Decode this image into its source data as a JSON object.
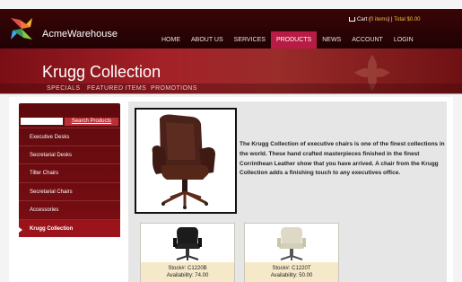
{
  "site": {
    "brand": "AcmeWarehouse",
    "cart": {
      "prefix": "Cart (",
      "items": "0 items",
      "separator": ") |",
      "total": "Total $0.00"
    },
    "nav": [
      "HOME",
      "ABOUT US",
      "SERVICES",
      "PRODUCTS",
      "NEWS",
      "ACCOUNT",
      "LOGIN"
    ],
    "active_nav": "PRODUCTS"
  },
  "banner": {
    "title": "Krugg Collection",
    "subnav": [
      "SPECIALS",
      "FEATURED ITEMS",
      "PROMOTIONS"
    ]
  },
  "sidebar": {
    "search": {
      "button": "Search Products",
      "value": ""
    },
    "items": [
      {
        "label": "Executive Desks"
      },
      {
        "label": "Secretarial Desks"
      },
      {
        "label": "Tilter Chairs"
      },
      {
        "label": "Secretarial Chairs"
      },
      {
        "label": "Accessories"
      },
      {
        "label": "Krugg Collection"
      }
    ]
  },
  "product": {
    "description": "The Krugg Collection of executive chairs is one of the finest collections in the world. These hand crafted masterpieces finished in the finest Corrinthean Leather show that you have arrived. A chair from the Krugg Collection adds a finishing touch to any executives office."
  },
  "cards": [
    {
      "stock": "Stock#: C1220B",
      "availability": "Availability: 74.00"
    },
    {
      "stock": "Stock#: C1220T",
      "availability": "Availability: 50.00"
    }
  ],
  "colors": {
    "header": "#2a0405",
    "accent": "#b81b46",
    "sidebar": "#6e0c11",
    "cart_highlight": "#f0c33c"
  }
}
